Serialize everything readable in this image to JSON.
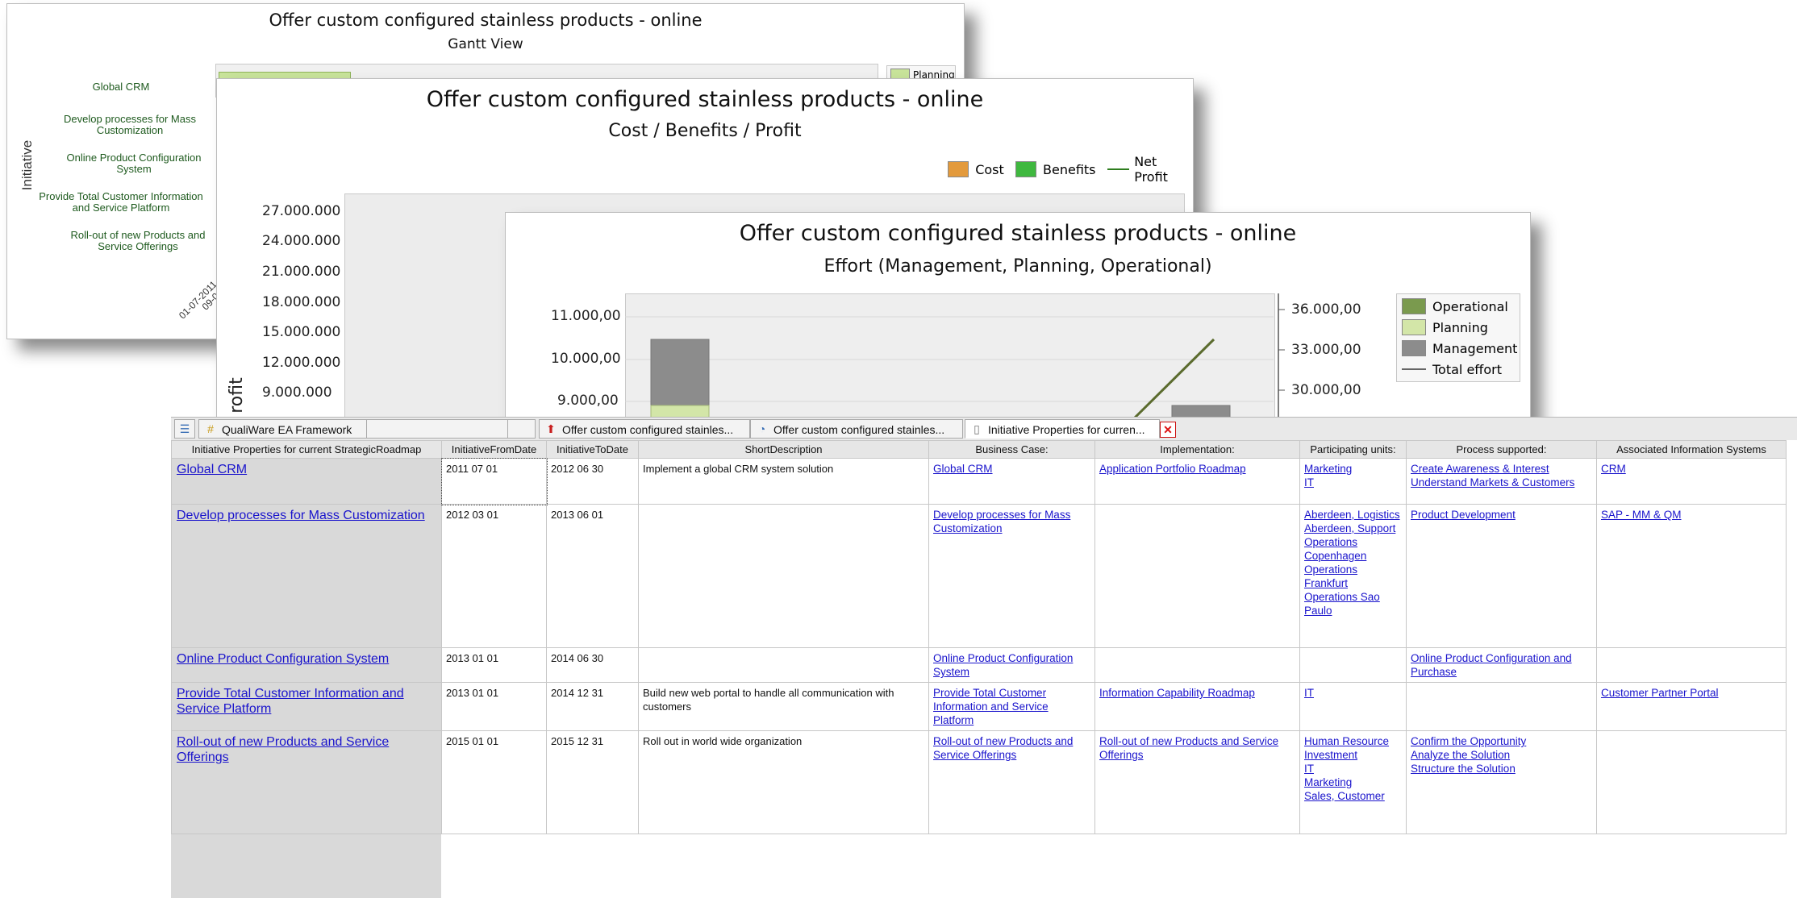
{
  "gantt_window": {
    "title": "Offer custom configured stainless products - online",
    "subtitle": "Gantt View",
    "y_axis_label": "Initiative",
    "initiatives": [
      "Global CRM",
      "Develop processes for Mass Customization",
      "Online Product Configuration System",
      "Provide Total Customer Information and Service Platform",
      "Roll-out of new Products and Service Offerings"
    ],
    "x_tick_partial": [
      "01-07-2011",
      "09-0"
    ],
    "legend_item": "Planning"
  },
  "cost_window": {
    "title": "Offer custom configured stainless products - online",
    "subtitle": "Cost / Benefits / Profit",
    "y_axis_label_partial": "rofit",
    "legend": [
      {
        "label": "Cost",
        "color": "#e39a3c"
      },
      {
        "label": "Benefits",
        "color": "#3fb83f"
      },
      {
        "label": "Net Profit",
        "color": "#2e7d1e"
      }
    ],
    "y_ticks": [
      "27.000.000",
      "24.000.000",
      "21.000.000",
      "18.000.000",
      "15.000.000",
      "12.000.000",
      "9.000.000"
    ]
  },
  "effort_window": {
    "title": "Offer custom configured stainless products - online",
    "subtitle": "Effort (Management, Planning, Operational)",
    "y_left_ticks": [
      "11.000,00",
      "10.000,00",
      "9.000,00"
    ],
    "y_right_ticks": [
      "36.000,00",
      "33.000,00",
      "30.000,00"
    ],
    "legend": [
      {
        "label": "Operational",
        "color": "#7a9a4e"
      },
      {
        "label": "Planning",
        "color": "#d3e6a8"
      },
      {
        "label": "Management",
        "color": "#8c8c8c"
      },
      {
        "label": "Total effort",
        "color": "#666666"
      }
    ]
  },
  "tabs": [
    {
      "icon": "list-icon",
      "label": ""
    },
    {
      "icon": "grid-icon",
      "label": "QualiWare EA Framework"
    },
    {
      "icon": "arrow-up-icon",
      "label": "Offer custom configured stainles..."
    },
    {
      "icon": "chart-icon",
      "label": "Offer custom configured stainles..."
    },
    {
      "icon": "document-icon",
      "label": "Initiative Properties for curren..."
    }
  ],
  "close_button_label": "✕",
  "table": {
    "headers": [
      "Initiative Properties for current StrategicRoadmap",
      "InitiativeFromDate",
      "InitiativeToDate",
      "ShortDescription",
      "Business Case:",
      "Implementation:",
      "Participating units:",
      "Process supported:",
      "Associated Information Systems"
    ],
    "rows": [
      {
        "name": "Global CRM",
        "from": "2011 07 01",
        "to": "2012 06 30",
        "desc": "Implement a global CRM system solution",
        "business_case": "Global CRM",
        "implementation": "Application Portfolio Roadmap",
        "units": "Marketing\nIT",
        "process": "Create Awareness & Interest\nUnderstand Markets & Customers",
        "systems": "CRM"
      },
      {
        "name": "Develop processes for Mass Customization",
        "from": "2012 03 01",
        "to": "2013 06 01",
        "desc": "",
        "business_case": "Develop processes for Mass Customization",
        "implementation": "",
        "units": "Aberdeen, Logistics\nAberdeen, Support Operations\nCopenhagen Operations\nFrankfurt Operations Sao Paulo",
        "process": "Product Development",
        "systems": "SAP - MM & QM"
      },
      {
        "name": "Online Product Configuration System",
        "from": "2013 01 01",
        "to": "2014 06 30",
        "desc": "",
        "business_case": "Online Product Configuration System",
        "implementation": "",
        "units": "",
        "process": "Online Product Configuration and Purchase",
        "systems": ""
      },
      {
        "name": "Provide Total Customer Information and Service Platform",
        "from": "2013 01 01",
        "to": "2014 12 31",
        "desc": "Build new web portal to handle all communication with customers",
        "business_case": "Provide Total Customer Information and Service Platform",
        "implementation": "Information Capability Roadmap",
        "units": "IT",
        "process": "",
        "systems": "Customer Partner Portal"
      },
      {
        "name": "Roll-out of new Products and Service Offerings",
        "from": "2015 01 01",
        "to": "2015 12 31",
        "desc": "Roll out in world wide organization",
        "business_case": "Roll-out of new Products and Service Offerings",
        "implementation": "Roll-out of new Products and Service Offerings",
        "units": "Human Resource\nInvestment\nIT\nMarketing\nSales, Customer",
        "process": "Confirm the Opportunity\nAnalyze the Solution\nStructure the Solution",
        "systems": ""
      }
    ]
  }
}
